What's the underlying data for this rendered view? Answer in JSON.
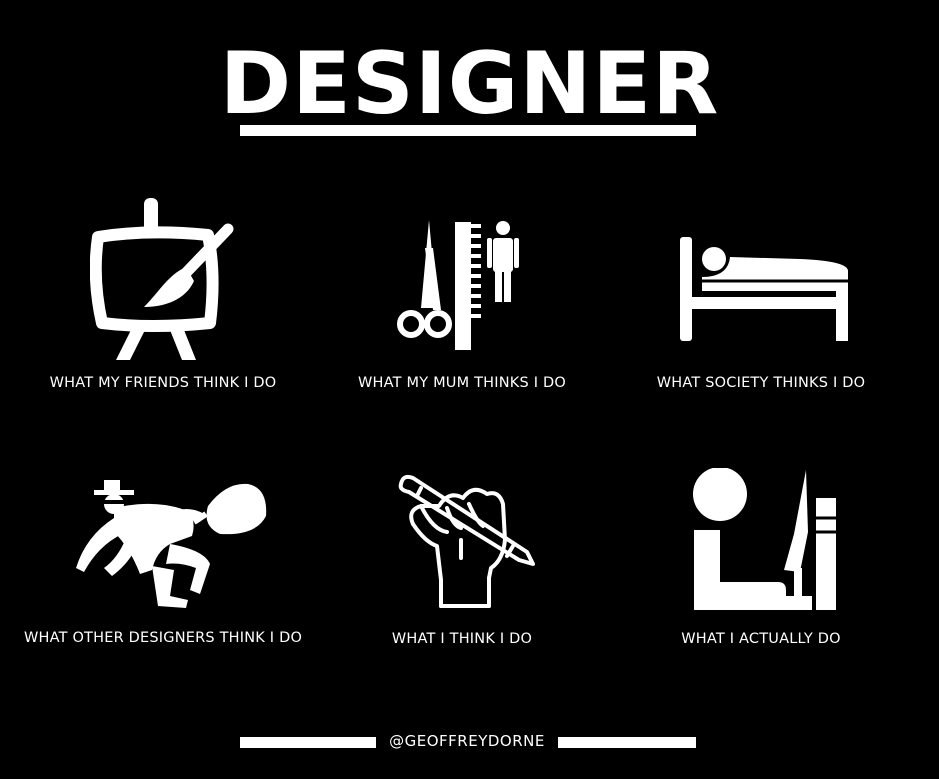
{
  "title": "DESIGNER",
  "cells": [
    {
      "caption": "WHAT MY FRIENDS THINK I DO",
      "icon": "easel-paintbrush-icon"
    },
    {
      "caption": "WHAT MY MUM THINKS I DO",
      "icon": "scissors-comb-person-icon"
    },
    {
      "caption": "WHAT SOCIETY THINKS I DO",
      "icon": "person-in-bed-icon"
    },
    {
      "caption": "WHAT OTHER DESIGNERS THINK I DO",
      "icon": "thief-with-sack-icon"
    },
    {
      "caption": "WHAT I THINK I DO",
      "icon": "fist-holding-pencil-icon"
    },
    {
      "caption": "WHAT I ACTUALLY DO",
      "icon": "person-at-computer-icon"
    }
  ],
  "footer": {
    "handle": "@GEOFFREYDORNE"
  },
  "colors": {
    "background": "#000000",
    "foreground": "#ffffff"
  }
}
